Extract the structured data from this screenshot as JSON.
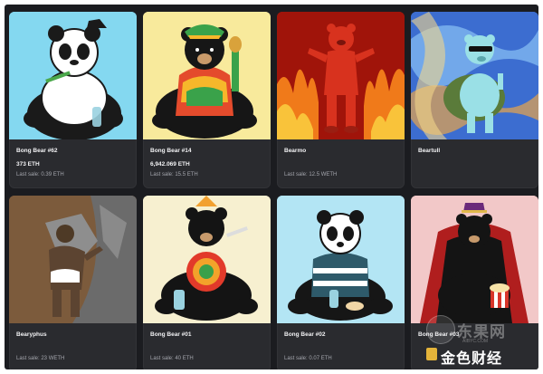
{
  "cards": [
    {
      "name": "Bong Bear #62",
      "price": "373 ETH",
      "last_sale": "Last sale: 0.39 ETH",
      "art": "panda-bear-icon"
    },
    {
      "name": "Bong Bear #14",
      "price": "6,942.069 ETH",
      "last_sale": "Last sale: 15.5 ETH",
      "art": "black-bear-icon"
    },
    {
      "name": "Bearmo",
      "price": "",
      "last_sale": "Last sale: 12.5 WETH",
      "art": "red-bear-icon"
    },
    {
      "name": "Beartull",
      "price": "",
      "last_sale": "",
      "art": "turtle-bear-icon"
    },
    {
      "name": "Bearyphus",
      "price": "",
      "last_sale": "Last sale: 23 WETH",
      "art": "boulder-bear-icon"
    },
    {
      "name": "Bong Bear #01",
      "price": "",
      "last_sale": "Last sale: 40 ETH",
      "art": "black-bear-icon"
    },
    {
      "name": "Bong Bear #02",
      "price": "",
      "last_sale": "Last sale: 0.07 ETH",
      "art": "panda-bear-icon"
    },
    {
      "name": "Bong Bear #03",
      "price": "",
      "last_sale": "",
      "art": "caped-bear-icon"
    }
  ],
  "watermark": {
    "top_text": "东果网",
    "sub_text": "AIBYC.COM",
    "bottom_text": "金色财经"
  }
}
